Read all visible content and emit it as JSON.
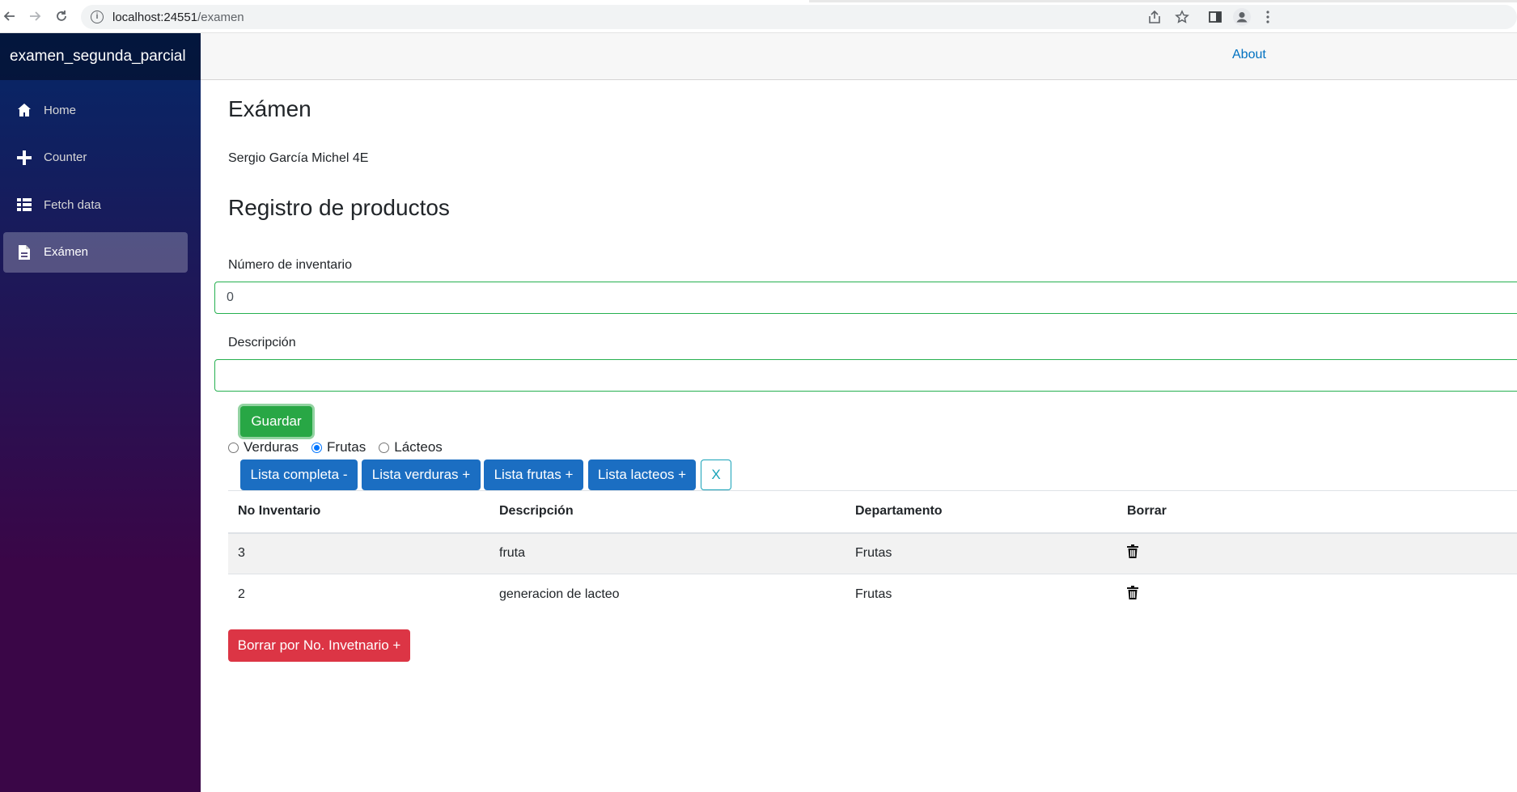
{
  "browser": {
    "url_host": "localhost:24551",
    "url_path": "/examen"
  },
  "sidebar": {
    "brand": "examen_segunda_parcial",
    "items": [
      {
        "label": "Home",
        "icon": "home-icon"
      },
      {
        "label": "Counter",
        "icon": "plus-icon"
      },
      {
        "label": "Fetch data",
        "icon": "list-icon"
      },
      {
        "label": "Exámen",
        "icon": "document-icon",
        "active": true
      }
    ]
  },
  "top_row": {
    "about": "About"
  },
  "main": {
    "title": "Exámen",
    "student": "Sergio García Michel 4E",
    "section_title": "Registro de productos",
    "inventory_label": "Número de inventario",
    "inventory_value": "0",
    "description_label": "Descripción",
    "description_value": "",
    "save_button": "Guardar",
    "radios": [
      {
        "label": "Verduras",
        "checked": false
      },
      {
        "label": "Frutas",
        "checked": true
      },
      {
        "label": "Lácteos",
        "checked": false
      }
    ],
    "list_buttons": [
      "Lista completa -",
      "Lista verduras +",
      "Lista frutas +",
      "Lista lacteos +"
    ],
    "clear_button": "X",
    "table": {
      "headers": [
        "No Inventario",
        "Descripción",
        "Departamento",
        "Borrar"
      ],
      "rows": [
        {
          "inventory": "3",
          "description": "fruta",
          "department": "Frutas"
        },
        {
          "inventory": "2",
          "description": "generacion de lacteo",
          "department": "Frutas"
        }
      ]
    },
    "delete_by_inventory_button": "Borrar por No. Invetnario +"
  },
  "colors": {
    "sidebar_top": "#052767",
    "sidebar_bottom": "#3a0647",
    "success": "#28a745",
    "primary": "#1b6ec2",
    "danger": "#dc3545"
  }
}
